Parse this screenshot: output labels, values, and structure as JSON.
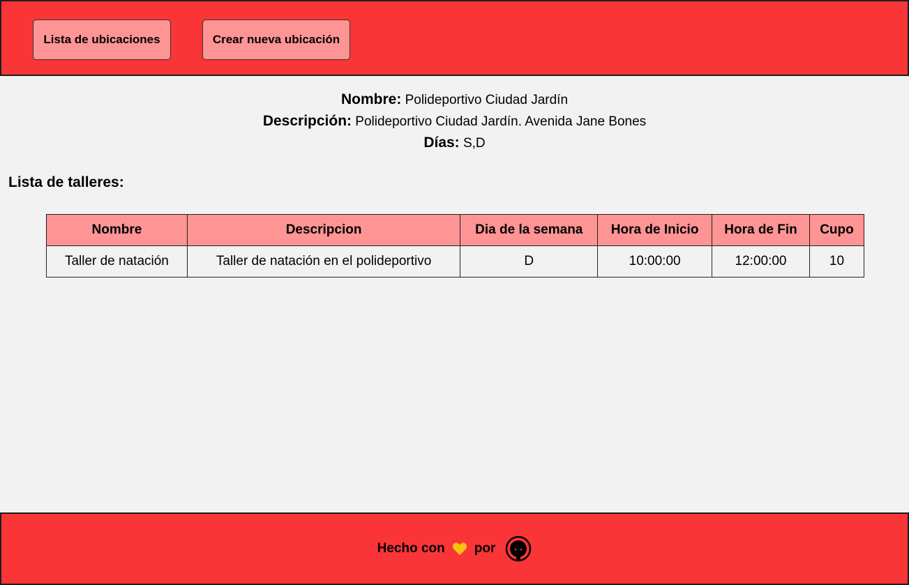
{
  "header": {
    "nav": [
      {
        "label": "Lista de ubicaciones"
      },
      {
        "label": "Crear nueva ubicación"
      }
    ]
  },
  "location": {
    "name_key": "Nombre:",
    "name_value": "Polideportivo Ciudad Jardín",
    "description_key": "Descripción:",
    "description_value": "Polideportivo Ciudad Jardín. Avenida Jane Bones",
    "days_key": "Días:",
    "days_value": "S,D"
  },
  "workshops": {
    "title": "Lista de talleres:",
    "columns": [
      "Nombre",
      "Descripcion",
      "Dia de la semana",
      "Hora de Inicio",
      "Hora de Fin",
      "Cupo"
    ],
    "rows": [
      [
        "Taller de natación",
        "Taller de natación en el polideportivo",
        "D",
        "10:00:00",
        "12:00:00",
        "10"
      ]
    ]
  },
  "footer": {
    "made_with": "Hecho con",
    "by": "por",
    "heart_icon": "yellow-heart-icon",
    "github_icon": "github-icon",
    "heart_color": "#f9c20b"
  },
  "colors": {
    "header_bg": "#fa3538",
    "button_bg": "#ff9495",
    "page_bg": "#f2f2f2"
  }
}
